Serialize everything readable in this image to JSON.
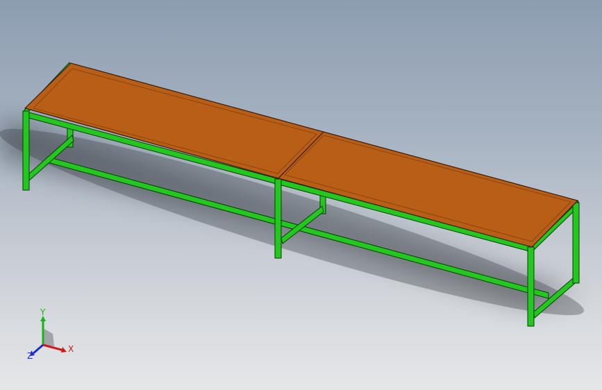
{
  "viewport": {
    "background_top": "#8d9db1",
    "background_bottom": "#e6e7e9"
  },
  "model": {
    "frame_color": "#22c81e",
    "frame_edge_color": "#0b3a08",
    "top_color": "#b95e16",
    "top_edge_color": "#3a1a05"
  },
  "triad": {
    "x_label": "X",
    "y_label": "Y",
    "z_label": "Z",
    "x_color": "#d01818",
    "y_color": "#18b418",
    "z_color": "#1a2ad0"
  }
}
